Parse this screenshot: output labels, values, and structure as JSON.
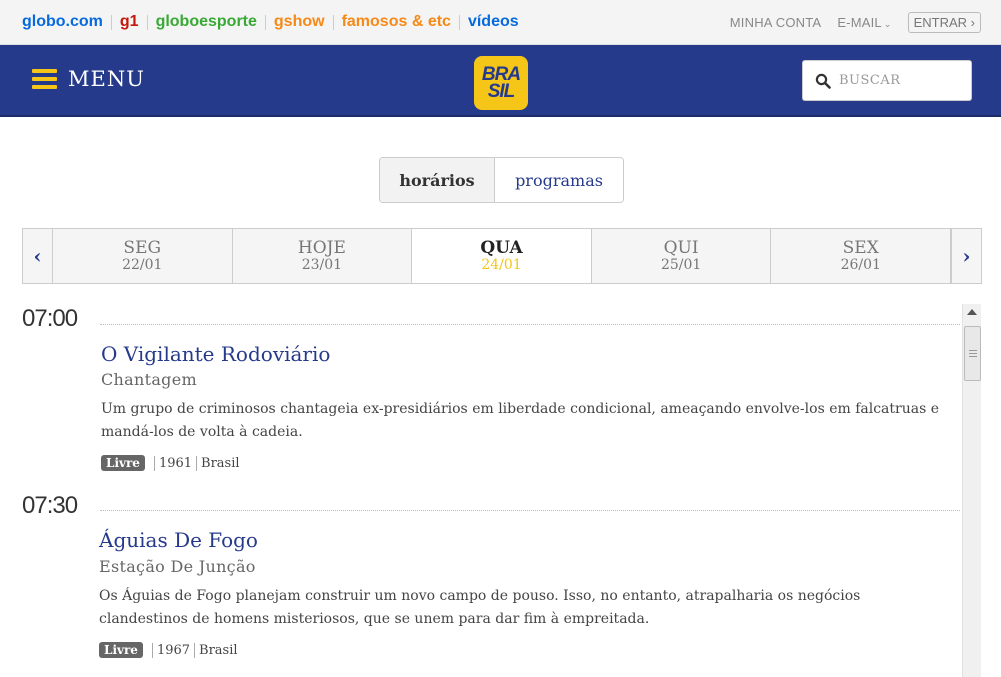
{
  "topbar": {
    "brands": [
      {
        "label": "globo.com",
        "color": "#0669de"
      },
      {
        "label": "g1",
        "color": "#c4170c"
      },
      {
        "label": "globoesporte",
        "color": "#39a935"
      },
      {
        "label": "gshow",
        "color": "#f68a18"
      },
      {
        "label": "famosos & etc",
        "color": "#f68a18"
      },
      {
        "label": "vídeos",
        "color": "#0669de"
      }
    ],
    "account": "MINHA CONTA",
    "email": "E-MAIL",
    "enter": "ENTRAR ›"
  },
  "header": {
    "menu_label": "MENU",
    "logo_line1": "BRA",
    "logo_line2": "SIL",
    "search_placeholder": "BUSCAR",
    "bg_color": "#263a8c",
    "accent_color": "#f5c518"
  },
  "toggle": {
    "active": "horários",
    "inactive": "programas"
  },
  "days": [
    {
      "name": "SEG",
      "date": "22/01",
      "selected": false
    },
    {
      "name": "HOJE",
      "date": "23/01",
      "selected": false
    },
    {
      "name": "QUA",
      "date": "24/01",
      "selected": true
    },
    {
      "name": "QUI",
      "date": "25/01",
      "selected": false
    },
    {
      "name": "SEX",
      "date": "26/01",
      "selected": false
    }
  ],
  "schedule": [
    {
      "time": "07:00",
      "title": "O Vigilante Rodoviário",
      "episode": "Chantagem",
      "description": "Um grupo de criminosos chantageia ex-presidiários em liberdade condicional, ameaçando envolve-los em falcatruas e mandá-los de volta à cadeia.",
      "rating": "Livre",
      "year": "1961",
      "country": "Brasil"
    },
    {
      "time": "07:30",
      "title": "Águias De Fogo",
      "episode": "Estação De Junção",
      "description": "Os Águias de Fogo planejam construir um novo campo de pouso. Isso, no entanto, atrapalharia os negócios clandestinos de homens misteriosos, que se unem para dar fim à empreitada.",
      "rating": "Livre",
      "year": "1967",
      "country": "Brasil"
    }
  ]
}
